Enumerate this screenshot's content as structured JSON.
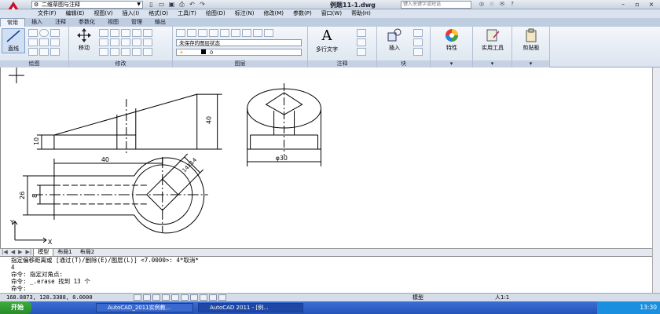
{
  "titlebar": {
    "workspace": "二维草图与注释",
    "document_title": "例题11-1.dwg",
    "search_placeholder": "键入关键字或短语"
  },
  "menu": [
    "文件(F)",
    "编辑(E)",
    "视图(V)",
    "插入(I)",
    "格式(O)",
    "工具(T)",
    "绘图(D)",
    "标注(N)",
    "修改(M)",
    "参数(P)",
    "窗口(W)",
    "帮助(H)"
  ],
  "tabs": [
    "常用",
    "插入",
    "注释",
    "参数化",
    "视图",
    "管理",
    "输出"
  ],
  "ribbon": {
    "line_label": "直线",
    "move_label": "移动",
    "layer_state": "未保存的图层状态",
    "layer_current": "0",
    "mtext_label": "多行文字",
    "insert_label": "插入",
    "properties_label": "特性",
    "utilities_label": "实用工具",
    "clipboard_label": "剪贴板",
    "panels": {
      "draw": "绘图",
      "modify": "修改",
      "layers": "图层",
      "annotation": "注释",
      "block": "块"
    }
  },
  "drawing": {
    "dim_40_top": "40",
    "dim_40_vertical": "40",
    "dim_10": "10",
    "dim_26": "26",
    "dim_8": "8",
    "dim_phi30": "φ30",
    "dim_diag": "14X14",
    "ucs_x": "X",
    "ucs_y": "Y"
  },
  "layout_tabs": [
    "模型",
    "布局1",
    "布局2"
  ],
  "command_lines": [
    "指定偏移距离或 [通过(T)/删除(E)/图层(L)] <7.0000>:  4*取消*",
    "4",
    "命令: 指定对角点:",
    "命令: _.erase 找到 13 个",
    "命令:"
  ],
  "status": {
    "coords": "168.8873, 128.3388, 0.0000",
    "model": "模型",
    "scale": "人1:1"
  },
  "taskbar": {
    "start": "开始",
    "tasks": [
      "AutoCAD_2011实例教...",
      "AutoCAD 2011 - [例..."
    ],
    "clock": "13:30"
  }
}
